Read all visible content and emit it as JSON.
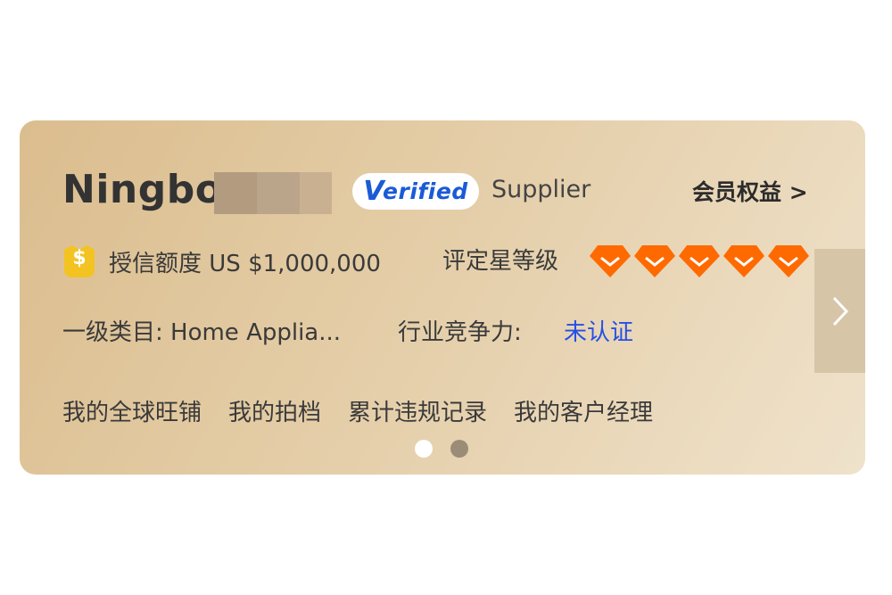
{
  "header": {
    "company_name": "Ningbo",
    "verified_label": "erified",
    "verified_initial": "V",
    "supplier_label": "Supplier",
    "benefits_label": "会员权益 >"
  },
  "credit": {
    "icon": "coin-shield-icon",
    "text": "授信额度 US $1,000,000"
  },
  "rating": {
    "label": "评定星等级",
    "diamonds": 5,
    "diamond_color": "#ff6a00"
  },
  "category": {
    "text": "一级类目: Home Applia..."
  },
  "competitiveness": {
    "label": "行业竞争力:",
    "value": "未认证"
  },
  "links": [
    "我的全球旺铺",
    "我的拍档",
    "累计违规记录",
    "我的客户经理"
  ],
  "pagination": {
    "total": 2,
    "active": 1
  },
  "colors": {
    "verified_blue": "#1a5bd6",
    "link_blue": "#2450e6",
    "blur_tones": [
      "#b39b80",
      "#bba58a",
      "#c9b091"
    ]
  }
}
